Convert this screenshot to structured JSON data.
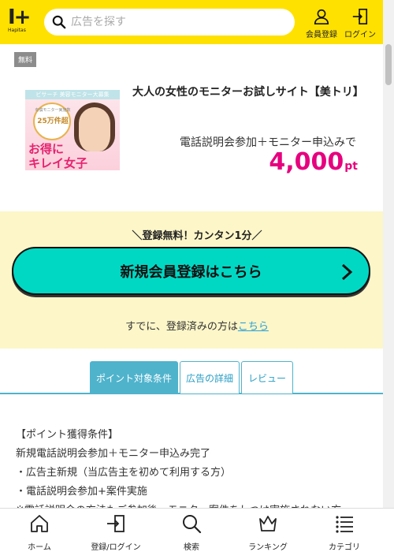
{
  "header": {
    "logo_text": "I+",
    "logo_sub": "Hapitas",
    "search_placeholder": "広告を探す",
    "member_label": "会員登録",
    "login_label": "ログイン"
  },
  "ad": {
    "badge": "無料",
    "image_texts": {
      "top": "ビサーチ 美容モニター大募集",
      "circle_small": "有償モニター実施数",
      "circle_big": "25万件超",
      "line1": "お得に",
      "line2": "キレイ女子"
    },
    "title": "大人の女性のモニターお試しサイト【美トリ】",
    "condition": "電話説明会参加＋モニター申込みで",
    "points": "4,000",
    "points_unit": "pt"
  },
  "register": {
    "headline": "＼登録無料！カンタン1分／",
    "button_label": "新規会員登録はこちら",
    "already_text": "すでに、登録済みの方は",
    "already_link": "こちら"
  },
  "tabs": [
    {
      "label": "ポイント対象条件",
      "active": true
    },
    {
      "label": "広告の詳細",
      "active": false
    },
    {
      "label": "レビュー",
      "active": false
    }
  ],
  "content": {
    "lines": [
      "【ポイント獲得条件】",
      "新規電話説明会参加＋モニター申込み完了",
      "・広告主新規（当広告主を初めて利用する方）",
      "・電話説明会参加+案件実施",
      "※電話説明会の方法もご参加後、モニター案件をしつは実施されない方"
    ]
  },
  "bottom_nav": [
    {
      "label": "ホーム",
      "icon": "home-icon"
    },
    {
      "label": "登録/ログイン",
      "icon": "login-icon"
    },
    {
      "label": "検索",
      "icon": "search-icon"
    },
    {
      "label": "ランキング",
      "icon": "crown-icon"
    },
    {
      "label": "カテゴリ",
      "icon": "list-icon"
    }
  ],
  "colors": {
    "header_bg": "#ffe100",
    "accent_pink": "#e6007e",
    "button_teal": "#00d8c4",
    "panel_bg": "#fcf6c8",
    "tab_blue": "#4fb3cc"
  }
}
